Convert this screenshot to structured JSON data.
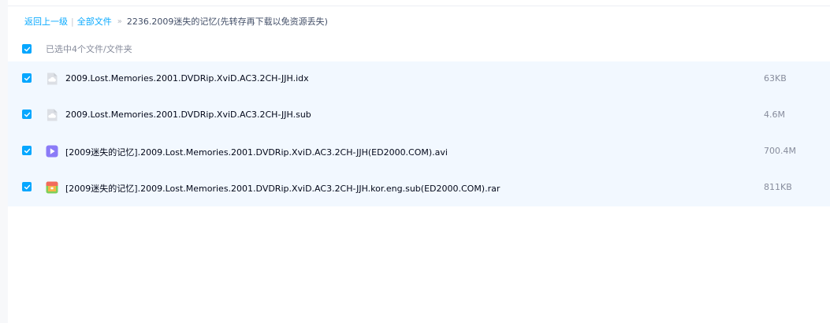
{
  "breadcrumb": {
    "back_label": "返回上一级",
    "separator": "|",
    "root_label": "全部文件",
    "chevron": "»",
    "current_label": "2236.2009迷失的记忆(先转存再下载以免资源丢失)"
  },
  "selection": {
    "summary": "已选中4个文件/文件夹"
  },
  "files": [
    {
      "name": "2009.Lost.Memories.2001.DVDRip.XviD.AC3.2CH-JJH.idx",
      "size": "63KB",
      "icon": "generic-file-icon"
    },
    {
      "name": "2009.Lost.Memories.2001.DVDRip.XviD.AC3.2CH-JJH.sub",
      "size": "4.6M",
      "icon": "generic-file-icon"
    },
    {
      "name": "[2009迷失的记忆].2009.Lost.Memories.2001.DVDRip.XviD.AC3.2CH-JJH(ED2000.COM).avi",
      "size": "700.4M",
      "icon": "video-file-icon"
    },
    {
      "name": "[2009迷失的记忆].2009.Lost.Memories.2001.DVDRip.XviD.AC3.2CH-JJH.kor.eng.sub(ED2000.COM).rar",
      "size": "811KB",
      "icon": "archive-file-icon"
    }
  ],
  "colors": {
    "accent": "#06a7ff",
    "link": "#09aaff",
    "row_background": "#f2f8ff",
    "secondary_text": "#878c9c"
  }
}
